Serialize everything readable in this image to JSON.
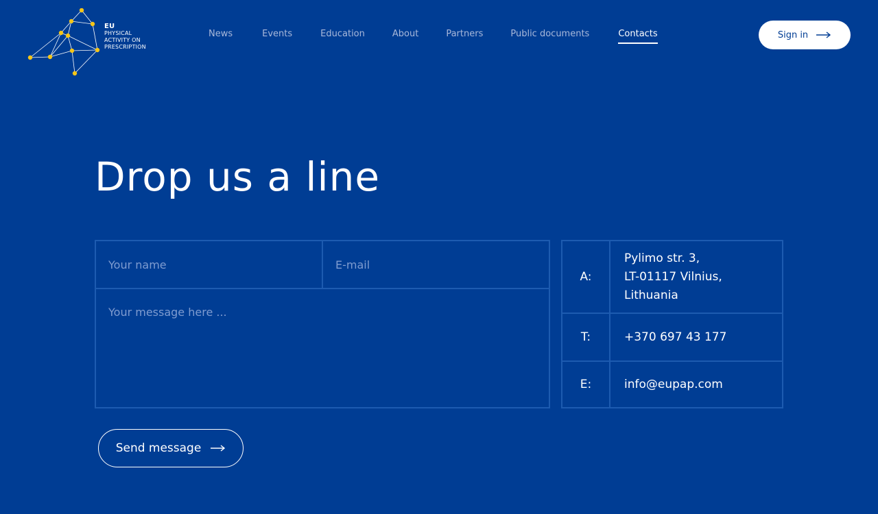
{
  "brand": {
    "logo_lines": [
      "EU",
      "PHYSICAL",
      "ACTIVITY ON",
      "PRESCRIPTION"
    ],
    "accent_color": "#f5c518"
  },
  "nav": {
    "items": [
      {
        "label": "News"
      },
      {
        "label": "Events"
      },
      {
        "label": "Education"
      },
      {
        "label": "About"
      },
      {
        "label": "Partners"
      },
      {
        "label": "Public documents"
      },
      {
        "label": "Contacts"
      }
    ],
    "active": "Contacts"
  },
  "header": {
    "signin_label": "Sign in",
    "signin_icon": "arrow-right-icon"
  },
  "main": {
    "heading": "Drop us a line",
    "form": {
      "name_placeholder": "Your name",
      "email_placeholder": "E-mail",
      "message_placeholder": "Your message here ...",
      "send_label": "Send message",
      "send_icon": "arrow-right-icon"
    },
    "contact": {
      "address_label": "A:",
      "address_lines": [
        "Pylimo str. 3,",
        "LT-01117 Vilnius,",
        "Lithuania"
      ],
      "phone_label": "T:",
      "phone": "+370 697 43 177",
      "email_label": "E:",
      "email": "info@eupap.com"
    }
  },
  "colors": {
    "background": "#003d94",
    "border": "#1d5bb0",
    "nav_inactive": "#a9b8da",
    "placeholder": "#7f9cd0"
  }
}
